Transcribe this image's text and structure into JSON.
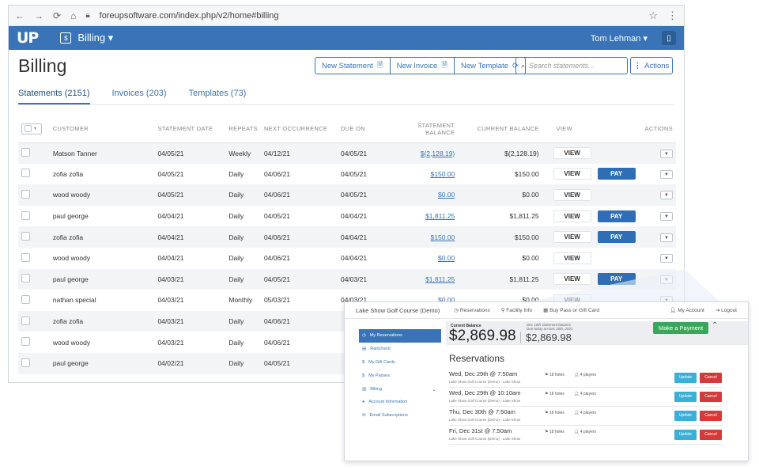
{
  "browser": {
    "url": "foreupsoftware.com/index.php/v2/home#billing"
  },
  "appbar": {
    "logo": "UP",
    "module": "Billing ▾",
    "user": "Tom Lehman ▾"
  },
  "page": {
    "title": "Billing",
    "new_statement": "New Statement",
    "new_invoice": "New Invoice",
    "new_template": "New Template",
    "search_placeholder": "Search statements...",
    "actions": "Actions"
  },
  "tabs": [
    {
      "label": "Statements (2151)"
    },
    {
      "label": "Invoices (203)"
    },
    {
      "label": "Templates (73)"
    }
  ],
  "table": {
    "columns": [
      "Customer",
      "Statement Date",
      "Repeats",
      "Next Occurrence",
      "Due On",
      "Statement Balance",
      "Current Balance",
      "View",
      "Actions"
    ],
    "view_label": "VIEW",
    "pay_label": "PAY",
    "rows": [
      {
        "customer": "Matson Tanner",
        "date": "04/05/21",
        "repeats": "Weekly",
        "next": "04/12/21",
        "due": "04/05/21",
        "stmt": "$(2,128.19)",
        "current": "$(2,128.19)"
      },
      {
        "customer": "zofia zofia",
        "date": "04/05/21",
        "repeats": "Daily",
        "next": "04/06/21",
        "due": "04/05/21",
        "stmt": "$150.00",
        "current": "$150.00"
      },
      {
        "customer": "wood woody",
        "date": "04/05/21",
        "repeats": "Daily",
        "next": "04/06/21",
        "due": "04/05/21",
        "stmt": "$0.00",
        "current": "$0.00"
      },
      {
        "customer": "paul george",
        "date": "04/04/21",
        "repeats": "Daily",
        "next": "04/05/21",
        "due": "04/04/21",
        "stmt": "$1,811.25",
        "current": "$1,811.25"
      },
      {
        "customer": "zofia zofia",
        "date": "04/04/21",
        "repeats": "Daily",
        "next": "04/06/21",
        "due": "04/04/21",
        "stmt": "$150.00",
        "current": "$150.00"
      },
      {
        "customer": "wood woody",
        "date": "04/04/21",
        "repeats": "Daily",
        "next": "04/06/21",
        "due": "04/04/21",
        "stmt": "$0.00",
        "current": "$0.00"
      },
      {
        "customer": "paul george",
        "date": "04/03/21",
        "repeats": "Daily",
        "next": "04/05/21",
        "due": "04/03/21",
        "stmt": "$1,811.25",
        "current": "$1,811.25"
      },
      {
        "customer": "nathan special",
        "date": "04/03/21",
        "repeats": "Monthly",
        "next": "05/03/21",
        "due": "04/03/21",
        "stmt": "$0.00",
        "current": "$0.00"
      },
      {
        "customer": "zofia zofia",
        "date": "04/03/21",
        "repeats": "Daily",
        "next": "04/06/21",
        "due": "",
        "stmt": "",
        "current": ""
      },
      {
        "customer": "wood woody",
        "date": "04/03/21",
        "repeats": "Daily",
        "next": "04/06/21",
        "due": "",
        "stmt": "",
        "current": ""
      },
      {
        "customer": "paul george",
        "date": "04/02/21",
        "repeats": "Daily",
        "next": "04/05/21",
        "due": "",
        "stmt": "",
        "current": ""
      }
    ]
  },
  "portal": {
    "course": "Lake Show Golf Course (Demo)",
    "top_links": [
      "Reservations",
      "Facility Info",
      "Buy Pass or Gift Card"
    ],
    "account": "My Account",
    "logout": "Logout",
    "sidebar": [
      "My Reservations",
      "Raincheck",
      "My Gift Cards",
      "My Passes",
      "Billing",
      "Account Information",
      "Email Subscriptions"
    ],
    "current_balance_label": "Current Balance",
    "current_balance": "$2,869.98",
    "statement_note_1": "Dec 19th statement balance",
    "statement_note_2": "Due today on Dec 20th, 2021",
    "statement_balance": "$2,869.98",
    "make_payment": "Make a Payment",
    "reservations_title": "Reservations",
    "update_label": "Update",
    "cancel_label": "Cancel",
    "reservations": [
      {
        "when": "Wed, Dec 29th @ 7:50am",
        "where": "Lake Show Golf Course (Demo) - Lake Show",
        "holes": "18 holes",
        "players": "4 players"
      },
      {
        "when": "Wed, Dec 29th @ 10:10am",
        "where": "Lake Show Golf Course (Demo) - Lake Show",
        "holes": "18 holes",
        "players": "4 players"
      },
      {
        "when": "Thu, Dec 30th @ 7:50am",
        "where": "Lake Show Golf Course (Demo) - Lake Show",
        "holes": "18 holes",
        "players": "4 players"
      },
      {
        "when": "Fri, Dec 31st @ 7:50am",
        "where": "Lake Show Golf Course (Demo) - Lake Show",
        "holes": "18 holes",
        "players": "4 players"
      }
    ]
  }
}
